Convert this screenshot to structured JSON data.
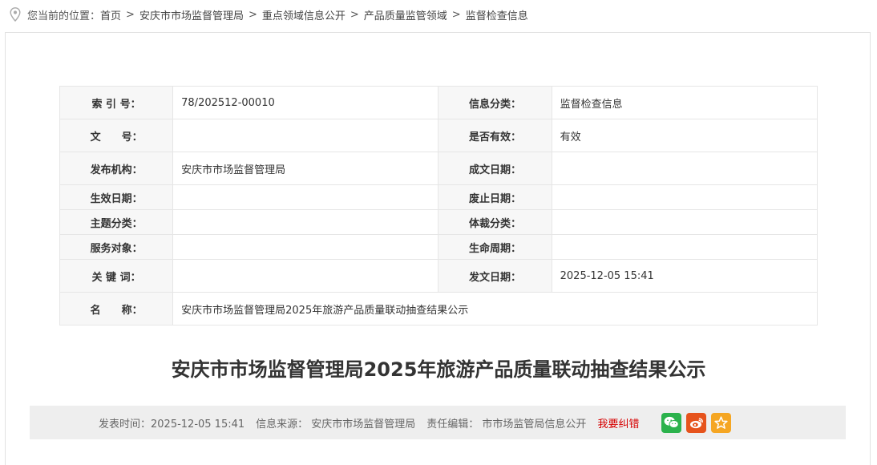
{
  "breadcrumb": {
    "lead": "您当前的位置：",
    "items": [
      "首页",
      "安庆市市场监督管理局",
      "重点领域信息公开",
      "产品质量监管领域",
      "监督检查信息"
    ],
    "separator": ">"
  },
  "meta": {
    "index_label": "索 引 号：",
    "index_value": "78/202512-00010",
    "category_label": "信息分类：",
    "category_value": "监督检查信息",
    "docno_label": "文　　号：",
    "docno_value": "",
    "valid_label": "是否有效：",
    "valid_value": "有效",
    "issuer_label": "发布机构：",
    "issuer_value": "安庆市市场监督管理局",
    "written_label": "成文日期：",
    "written_value": "",
    "effective_label": "生效日期：",
    "effective_value": "",
    "repeal_label": "废止日期：",
    "repeal_value": "",
    "topic_label": "主题分类：",
    "topic_value": "",
    "genre_label": "体裁分类：",
    "genre_value": "",
    "audience_label": "服务对象：",
    "audience_value": "",
    "lifecycle_label": "生命周期：",
    "lifecycle_value": "",
    "keywords_label": "关 键 词：",
    "keywords_value": "",
    "pubdate_label": "发文日期：",
    "pubdate_value": "2025-12-05 15:41",
    "name_label": "名　　称：",
    "name_value": "安庆市市场监督管理局2025年旅游产品质量联动抽查结果公示"
  },
  "article": {
    "title": "安庆市市场监督管理局2025年旅游产品质量联动抽查结果公示"
  },
  "infobar": {
    "publish_time": "发表时间：2025-12-05 15:41",
    "source": "信息来源： 安庆市市场监督管理局",
    "editor": "责任编辑： 市市场监管局信息公开",
    "report_error": "我要纠错"
  },
  "share": {
    "icons": [
      "wechat-icon",
      "weibo-icon",
      "favorite-icon"
    ]
  },
  "colors": {
    "wechat": "#2bb24c",
    "weibo": "#e6531c",
    "favorite": "#f5a623",
    "report": "#d60000"
  }
}
